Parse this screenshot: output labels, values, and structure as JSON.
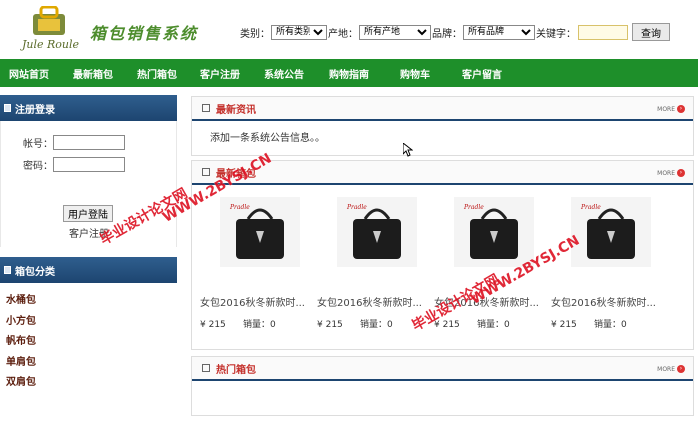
{
  "header": {
    "logo_sub": "Jule Roule",
    "site_name": "箱包销售系统",
    "search": {
      "category_label": "类别：",
      "category_value": "所有类别",
      "origin_label": "产地：",
      "origin_value": "所有产地",
      "brand_label": "品牌：",
      "brand_value": "所有品牌",
      "keyword_label": "关键字：",
      "keyword_value": "",
      "submit": "查询"
    }
  },
  "nav": [
    "网站首页",
    "最新箱包",
    "热门箱包",
    "客户注册",
    "系统公告",
    "购物指南",
    "购物车",
    "客户留言"
  ],
  "sidebar": {
    "login": {
      "title": "注册登录",
      "account_label": "帐号：",
      "password_label": "密码：",
      "submit": "用户登陆",
      "register": "客户注册"
    },
    "categories": {
      "title": "箱包分类",
      "items": [
        "水桶包",
        "小方包",
        "帆布包",
        "单肩包",
        "双肩包"
      ]
    }
  },
  "news": {
    "title": "最新资讯",
    "more": "MORE",
    "item": "添加一条系统公告信息。。"
  },
  "latest": {
    "title": "最新箱包",
    "more": "MORE",
    "products": [
      {
        "name": "女包2016秋冬新款时...",
        "price": "¥ 215",
        "sales": "销量：0"
      },
      {
        "name": "女包2016秋冬新款时...",
        "price": "¥ 215",
        "sales": "销量：0"
      },
      {
        "name": "女包2016秋冬新款时...",
        "price": "¥ 215",
        "sales": "销量：0"
      },
      {
        "name": "女包2016秋冬新款时...",
        "price": "¥ 215",
        "sales": "销量：0"
      }
    ]
  },
  "hot": {
    "title": "热门箱包",
    "more": "MORE"
  },
  "watermarks": [
    "毕业设计论文网",
    "WWW.2BYSJ.CN",
    "毕业设计论文网",
    "WWW.2BYSJ.CN"
  ],
  "colors": {
    "nav": "#1e8f2a",
    "box_head": "#1d4570",
    "panel_title": "#c4302b",
    "category": "#5c1e0e"
  }
}
